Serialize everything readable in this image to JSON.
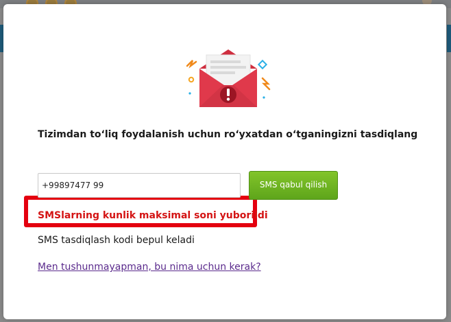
{
  "dialog": {
    "title": "Tizimdan to‘liq foydalanish uchun ro‘yxatdan o‘tganingizni tasdiqlang",
    "phone_value": "+99897477 99",
    "sms_button_label": "SMS qabul qilish",
    "error_message": "SMSlarning kunlik maksimal soni yuborildi",
    "info_message": "SMS tasdiqlash kodi bepul keladi",
    "help_link": "Men tushunmayapman, bu nima uchun kerak?"
  },
  "colors": {
    "accent_green": "#6cb521",
    "error_red": "#d41414",
    "highlight_border": "#e4000f",
    "link_purple": "#5a2a8c",
    "envelope_red": "#e0394b"
  },
  "icons": [
    "envelope-warning-icon"
  ]
}
